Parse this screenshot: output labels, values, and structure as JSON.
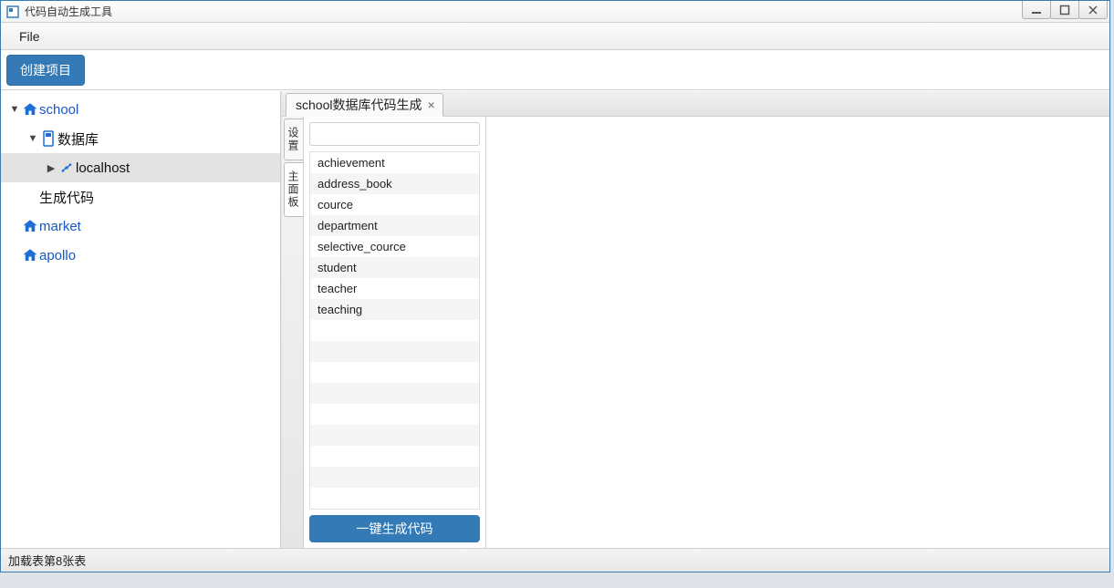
{
  "window": {
    "title": "代码自动生成工具"
  },
  "menu": {
    "file": "File"
  },
  "toolbar": {
    "create_project": "创建项目"
  },
  "tree": {
    "school": "school",
    "database": "数据库",
    "localhost": "localhost",
    "generate_code": "生成代码",
    "market": "market",
    "apollo": "apollo"
  },
  "tabs": {
    "active_label": "school数据库代码生成"
  },
  "side_tabs": {
    "settings": "设置",
    "main_panel": "主面板"
  },
  "search": {
    "value": ""
  },
  "tables": [
    "achievement",
    "address_book",
    "cource",
    "department",
    "selective_cource",
    "student",
    "teacher",
    "teaching",
    "",
    "",
    "",
    "",
    "",
    "",
    "",
    "",
    "",
    ""
  ],
  "actions": {
    "generate": "一键生成代码"
  },
  "status": {
    "text": "加载表第8张表"
  }
}
